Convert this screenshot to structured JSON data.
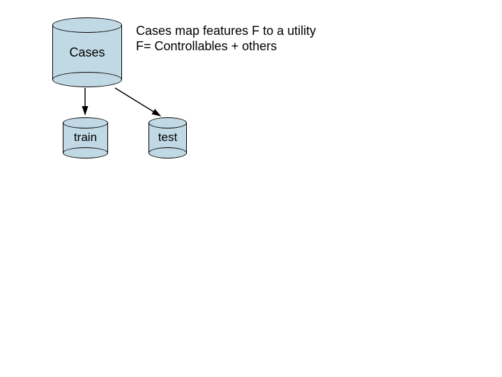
{
  "cases_label": "Cases",
  "train_label": "train",
  "test_label": "test",
  "caption_line1": "Cases map features F to a utility",
  "caption_line2": "F= Controllables + others"
}
